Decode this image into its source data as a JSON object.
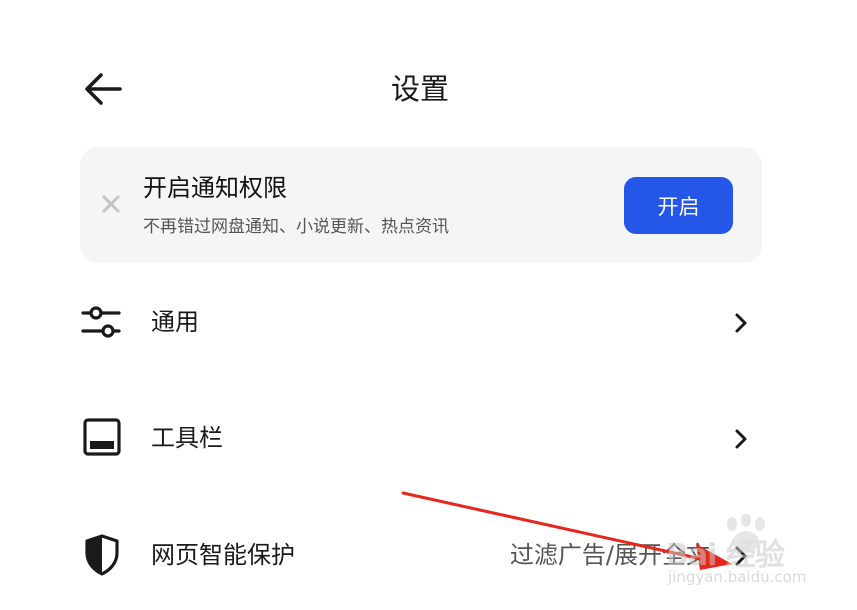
{
  "header": {
    "title": "设置",
    "back_icon": "arrow-left-icon"
  },
  "notification_banner": {
    "title": "开启通知权限",
    "subtitle": "不再错过网盘通知、小说更新、热点资讯",
    "button_label": "开启",
    "close_icon": "close-icon",
    "button_color": "#2456e8",
    "background_color": "#f5f5f5"
  },
  "settings_items": [
    {
      "label": "通用",
      "icon": "sliders-icon",
      "value": ""
    },
    {
      "label": "工具栏",
      "icon": "toolbar-icon",
      "value": ""
    },
    {
      "label": "网页智能保护",
      "icon": "shield-icon",
      "value": "过滤广告/展开全文"
    }
  ],
  "watermark": {
    "text": "Bai 经验",
    "url": "jingyan.baidu.com"
  },
  "colors": {
    "accent": "#2456e8",
    "annotation_arrow": "#e8261c"
  }
}
